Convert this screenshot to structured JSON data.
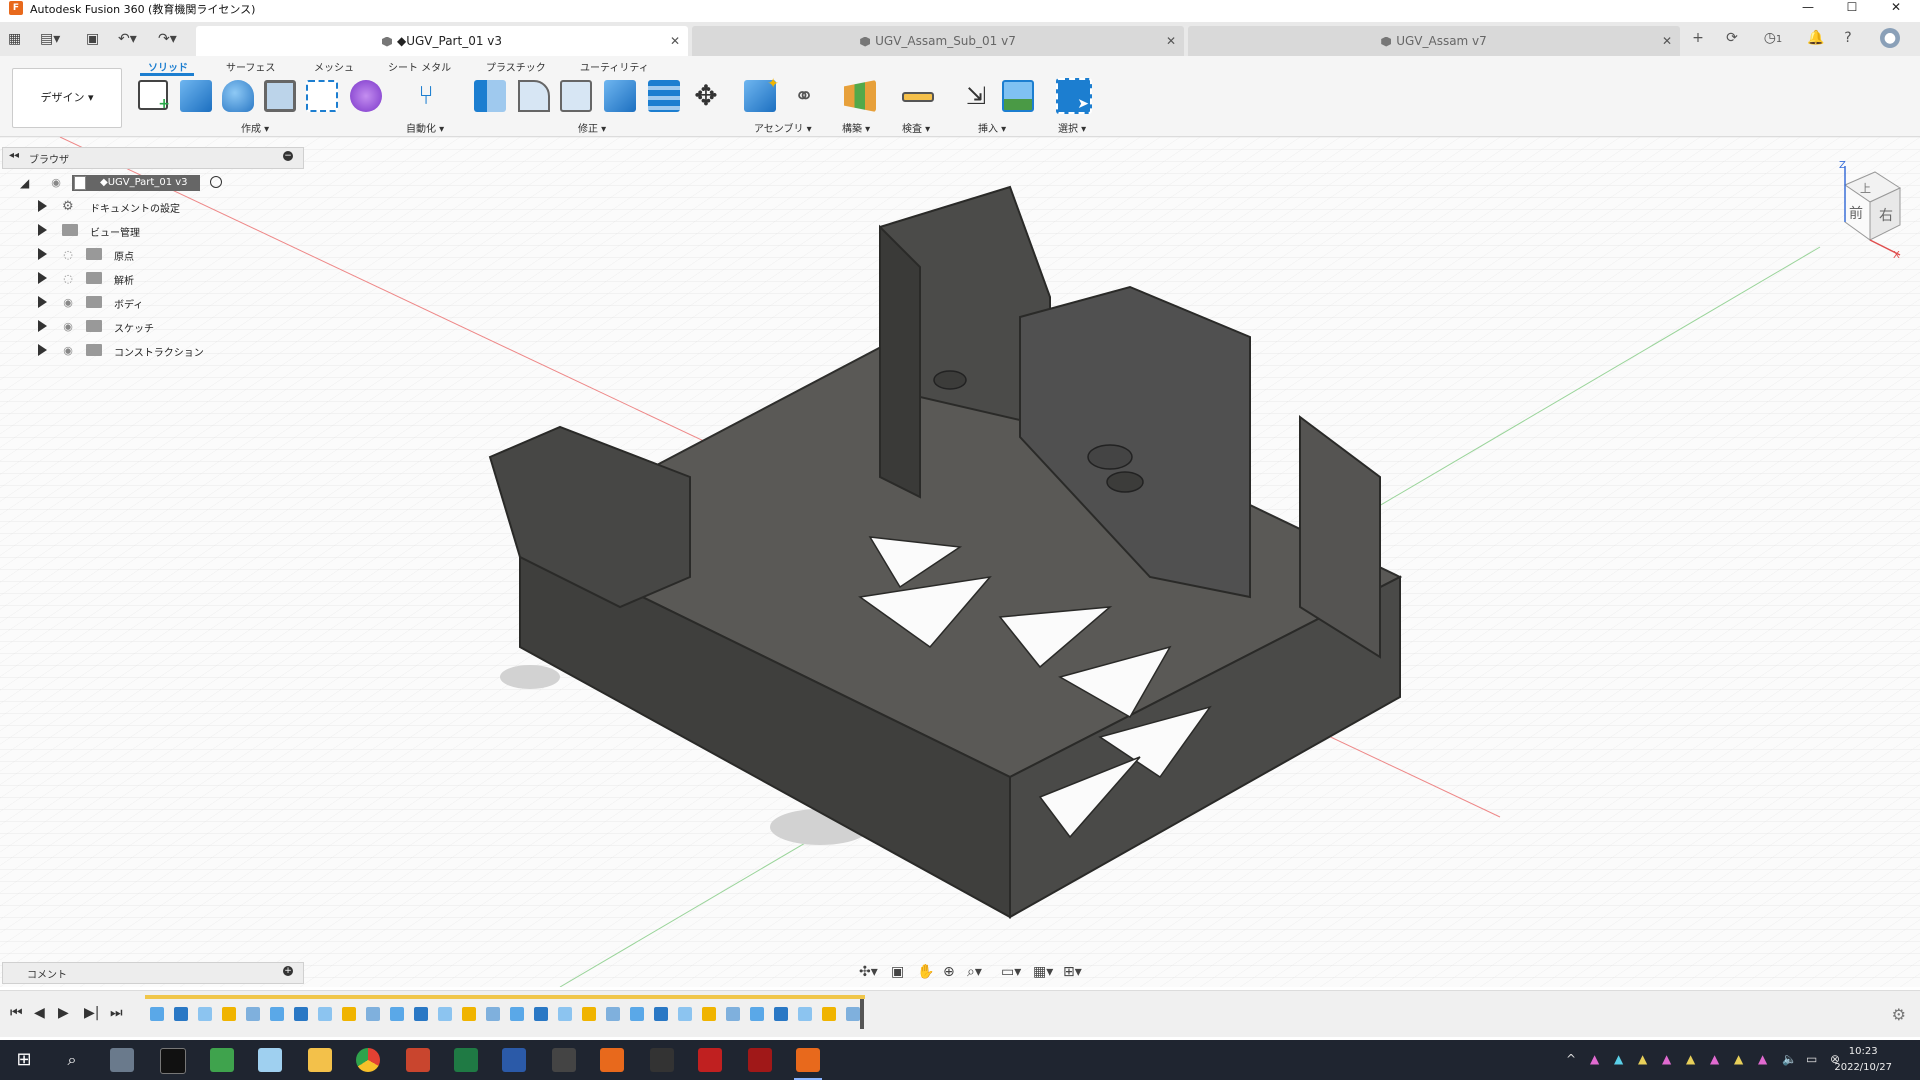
{
  "window": {
    "title": "Autodesk Fusion 360 (教育機関ライセンス)",
    "min_label": "—",
    "max_label": "☐",
    "close_label": "✕"
  },
  "tabs": [
    {
      "label": "◆UGV_Part_01 v3",
      "active": true
    },
    {
      "label": "UGV_Assam_Sub_01 v7",
      "active": false
    },
    {
      "label": "UGV_Assam v7",
      "active": false
    }
  ],
  "top_right": {
    "jobs_count": "1"
  },
  "ribbon": {
    "workspace": "デザイン",
    "tabs": [
      "ソリッド",
      "サーフェス",
      "メッシュ",
      "シート メタル",
      "プラスチック",
      "ユーティリティ"
    ],
    "groups": [
      "作成",
      "自動化",
      "修正",
      "アセンブリ",
      "構築",
      "検査",
      "挿入",
      "選択"
    ]
  },
  "browser": {
    "title": "ブラウザ",
    "root": "◆UGV_Part_01 v3",
    "items": [
      "ドキュメントの設定",
      "ビュー管理",
      "原点",
      "解析",
      "ボディ",
      "スケッチ",
      "コンストラクション"
    ]
  },
  "viewcube": {
    "top": "上",
    "front": "前",
    "right": "右",
    "axis_z": "Z",
    "axis_x": "X"
  },
  "comments": {
    "title": "コメント"
  },
  "taskbar": {
    "time": "10:23",
    "date": "2022/10/27"
  },
  "colors": {
    "accent": "#1c7ed0",
    "model": "#4a4a48",
    "timeline": "#f0c64a",
    "taskbar": "#1f2530"
  }
}
